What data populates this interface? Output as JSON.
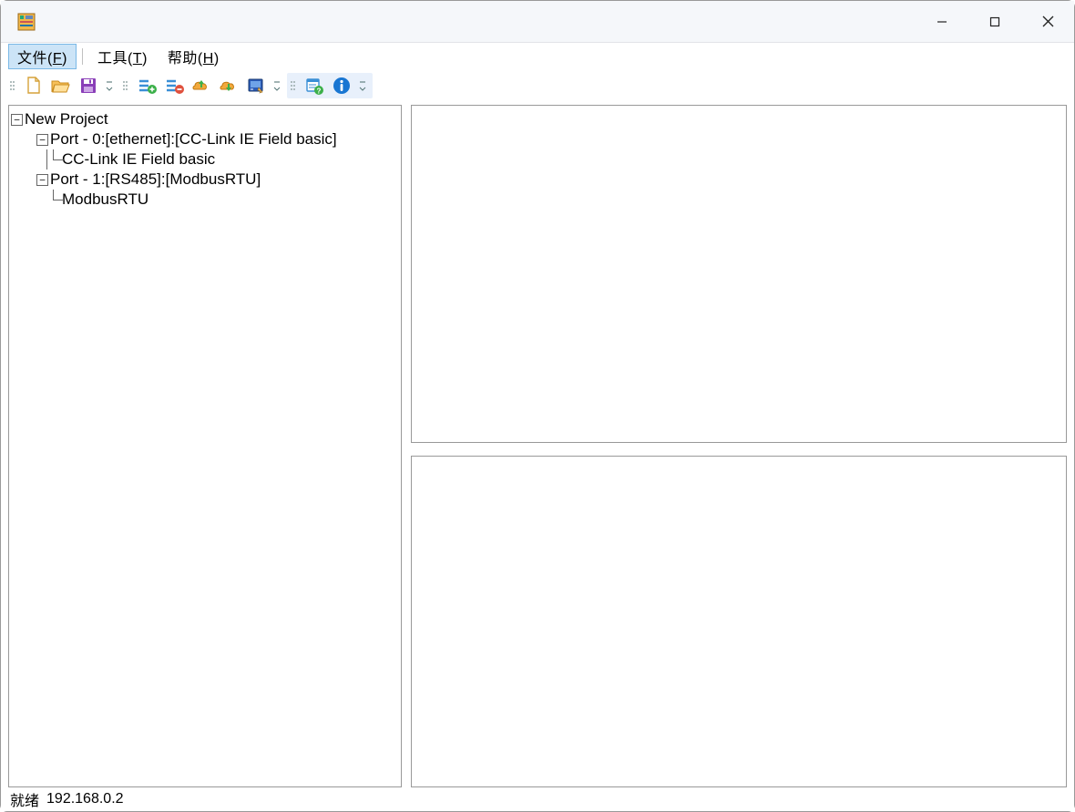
{
  "menubar": {
    "file": {
      "label": "文件",
      "accel": "F"
    },
    "tools": {
      "label": "工具",
      "accel": "T"
    },
    "help": {
      "label": "帮助",
      "accel": "H"
    }
  },
  "toolbar": {
    "new": "new-file-icon",
    "open": "open-folder-icon",
    "save": "save-icon",
    "add_node": "add-node-icon",
    "remove_node": "remove-node-icon",
    "upload": "upload-icon",
    "download": "download-icon",
    "device": "device-icon",
    "diagnose": "diagnose-icon",
    "info": "info-icon"
  },
  "tree": {
    "root": "New Project",
    "ports": [
      {
        "label": "Port - 0:[ethernet]:[CC-Link IE Field basic]",
        "children": [
          "CC-Link IE Field basic"
        ]
      },
      {
        "label": "Port - 1:[RS485]:[ModbusRTU]",
        "children": [
          "ModbusRTU"
        ]
      }
    ]
  },
  "statusbar": {
    "ready": "就绪",
    "ip": "192.168.0.2"
  }
}
